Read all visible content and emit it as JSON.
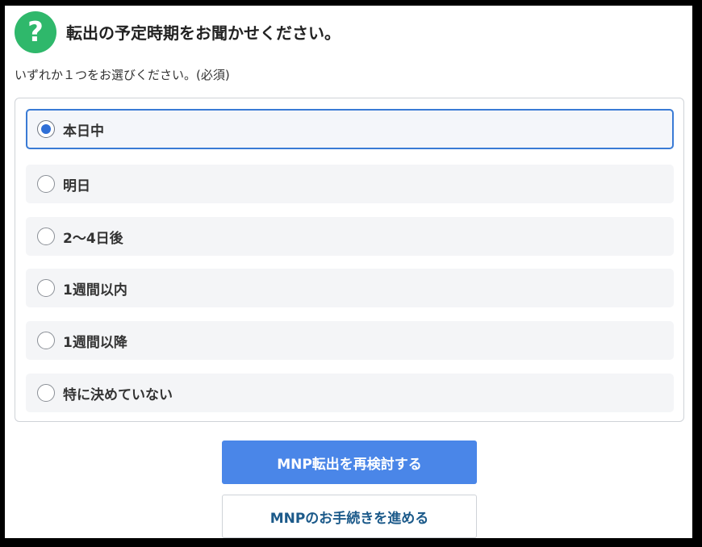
{
  "question": {
    "icon_symbol": "?",
    "title": "転出の予定時期をお聞かせください。",
    "instruction": "いずれか１つをお選びください。(必須)"
  },
  "options": [
    {
      "label": "本日中",
      "selected": true
    },
    {
      "label": "明日",
      "selected": false
    },
    {
      "label": "2〜4日後",
      "selected": false
    },
    {
      "label": "1週間以内",
      "selected": false
    },
    {
      "label": "1週間以降",
      "selected": false
    },
    {
      "label": "特に決めていない",
      "selected": false
    }
  ],
  "buttons": {
    "reconsider_label": "MNP転出を再検討する",
    "proceed_label": "MNPのお手続きを進める"
  },
  "colors": {
    "question_icon": "#2fb86b",
    "selected_border": "#3a7bd5",
    "radio_selected": "#2f6fd6",
    "primary_button": "#4a86e8",
    "secondary_button_text": "#1c5a8a"
  }
}
